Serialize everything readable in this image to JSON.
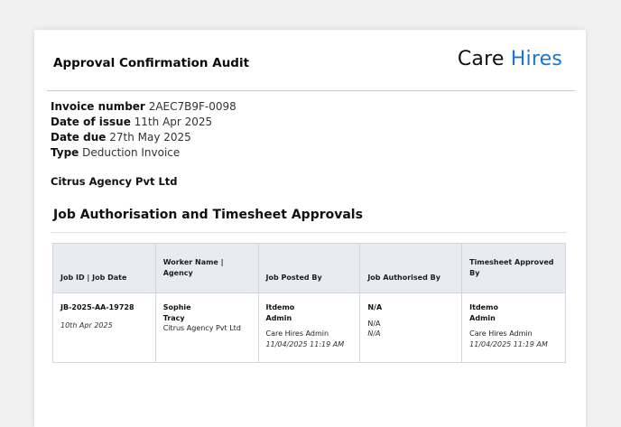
{
  "header": {
    "title": "Approval Confirmation Audit",
    "brand_part1": "Care",
    "brand_part2": "Hires"
  },
  "invoice": {
    "number_label": "Invoice number",
    "number_value": "2AEC7B9F-0098",
    "issue_label": "Date of issue",
    "issue_value": "11th Apr 2025",
    "due_label": "Date due",
    "due_value": "27th May 2025",
    "type_label": "Type",
    "type_value": "Deduction Invoice"
  },
  "agency_name": "Citrus Agency Pvt Ltd",
  "section_title": "Job Authorisation and Timesheet Approvals",
  "table": {
    "headers": {
      "col1": "Job ID | Job Date",
      "col2": "Worker Name | Agency",
      "col3": "Job Posted By",
      "col4": "Job Authorised By",
      "col5": "Timesheet Approved By"
    },
    "rows": [
      {
        "job_id": "JB-2025-AA-19728",
        "job_date": "10th Apr 2025",
        "worker_first": "Sophie",
        "worker_last": "Tracy",
        "worker_agency": "Citrus Agency Pvt Ltd",
        "posted_name1": "Itdemo",
        "posted_name2": "Admin",
        "posted_org": "Care Hires Admin",
        "posted_time": "11/04/2025 11:19 AM",
        "auth_name": "N/A",
        "auth_org": "N/A",
        "auth_time": "N/A",
        "ts_name1": "Itdemo",
        "ts_name2": "Admin",
        "ts_org": "Care Hires Admin",
        "ts_time": "11/04/2025 11:19 AM"
      }
    ]
  },
  "colors": {
    "brand_blue": "#1a73d9",
    "table_header_bg": "#e8ecf0"
  }
}
